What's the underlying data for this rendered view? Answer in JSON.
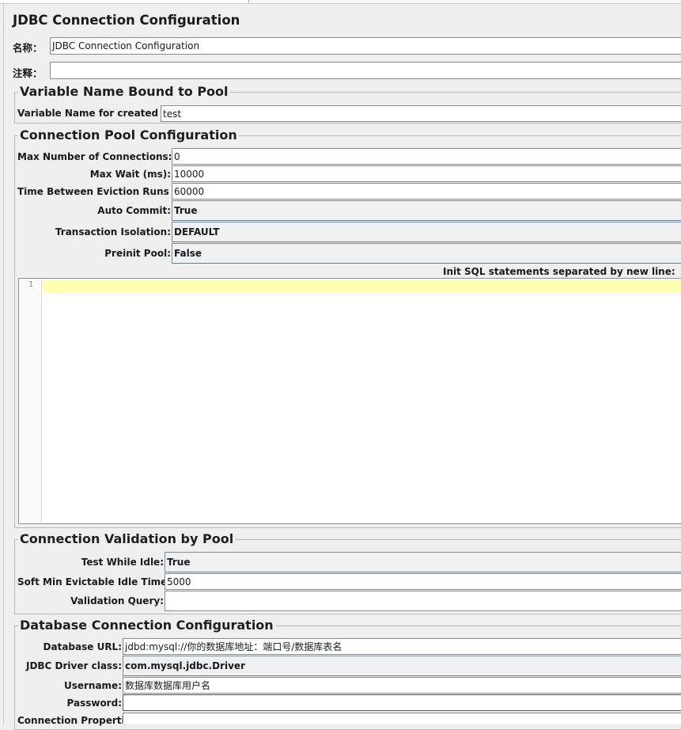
{
  "title": "JDBC Connection Configuration",
  "name_label": "名称：",
  "name_value": "JDBC Connection Configuration",
  "comment_label": "注释：",
  "comment_value": "",
  "variable_section": {
    "legend": "Variable Name Bound to Pool",
    "pool_var_label": "Variable Name for created pool:",
    "pool_var_value": "test"
  },
  "pool_section": {
    "legend": "Connection Pool Configuration",
    "max_connections_label": "Max Number of Connections:",
    "max_connections_value": "0",
    "max_wait_label": "Max Wait (ms):",
    "max_wait_value": "10000",
    "eviction_label": "Time Between Eviction Runs (ms):",
    "eviction_value": "60000",
    "auto_commit_label": "Auto Commit:",
    "auto_commit_value": "True",
    "isolation_label": "Transaction Isolation:",
    "isolation_value": "DEFAULT",
    "preinit_label": "Preinit Pool:",
    "preinit_value": "False",
    "init_sql_label": "Init SQL statements separated by new line:",
    "editor_line_number": "1"
  },
  "validation_section": {
    "legend": "Connection Validation by Pool",
    "test_idle_label": "Test While Idle:",
    "test_idle_value": "True",
    "soft_min_label": "Soft Min Evictable Idle Time(ms):",
    "soft_min_value": "5000",
    "validation_query_label": "Validation Query:",
    "validation_query_value": ""
  },
  "database_section": {
    "legend": "Database Connection Configuration",
    "url_label": "Database URL:",
    "url_value": "jdbd:mysql://你的数据库地址：端口号/数据库表名",
    "driver_label": "JDBC Driver class:",
    "driver_value": "com.mysql.jdbc.Driver",
    "username_label": "Username:",
    "username_value": "数据库数据库用户名",
    "password_label": "Password:",
    "password_value": "",
    "properties_label": "Connection Properties:"
  },
  "colors": {
    "background": "#efefef",
    "current_line_highlight": "#ffffb4",
    "field_border": "#8a8a8a"
  }
}
